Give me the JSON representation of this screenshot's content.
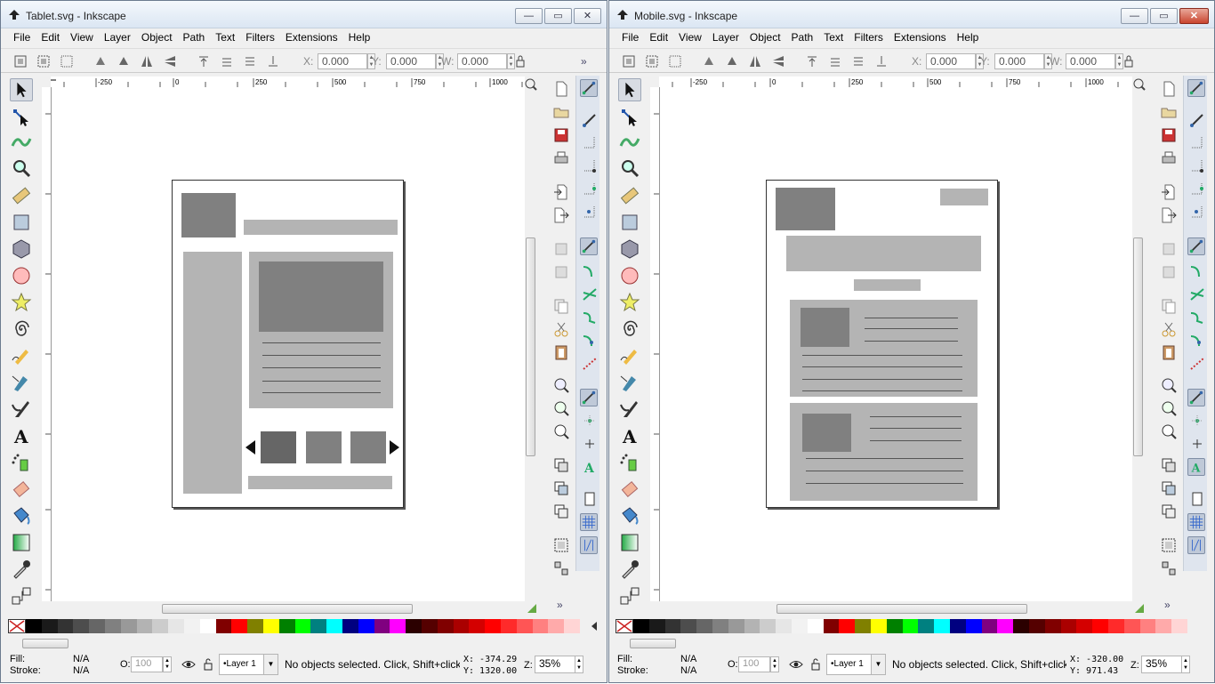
{
  "left_window": {
    "title": "Tablet.svg - Inkscape",
    "status": {
      "fill_label": "Fill:",
      "fill_value": "N/A",
      "stroke_label": "Stroke:",
      "stroke_value": "N/A",
      "opacity_label": "O:",
      "opacity_value": "100",
      "layer": "•Layer 1",
      "message": "No objects selected. Click, Shift+click",
      "x_readout": "X: -374.29",
      "y_readout": "Y: 1320.00",
      "zoom_label": "Z:",
      "zoom_value": "35%"
    }
  },
  "right_window": {
    "title": "Mobile.svg - Inkscape",
    "status": {
      "fill_label": "Fill:",
      "fill_value": "N/A",
      "stroke_label": "Stroke:",
      "stroke_value": "N/A",
      "opacity_label": "O:",
      "opacity_value": "100",
      "layer": "•Layer 1",
      "message": "No objects selected. Click, Shift+click",
      "x_readout": "X: -320.00",
      "y_readout": "Y:  971.43",
      "zoom_label": "Z:",
      "zoom_value": "35%"
    }
  },
  "menu": [
    "File",
    "Edit",
    "View",
    "Layer",
    "Object",
    "Path",
    "Text",
    "Filters",
    "Extensions",
    "Help"
  ],
  "toolbar": {
    "x_label": "X:",
    "x_value": "0.000",
    "y_label": "Y:",
    "y_value": "0.000",
    "w_label": "W:",
    "w_value": "0.000",
    "overflow": "»"
  },
  "window_buttons": {
    "minimize": "—",
    "maximize": "▭",
    "close": "✕"
  },
  "ruler": {
    "h_ticks": [
      "-250",
      "0",
      "250",
      "500",
      "750",
      "1000"
    ],
    "v_ticks_left": [
      "1250",
      "1000",
      "750",
      "500",
      "250",
      "0"
    ]
  },
  "palette_colors": [
    "#000000",
    "#1a1a1a",
    "#333333",
    "#4d4d4d",
    "#666666",
    "#808080",
    "#999999",
    "#b3b3b3",
    "#cccccc",
    "#e6e6e6",
    "#f2f2f2",
    "#ffffff",
    "#800000",
    "#ff0000",
    "#808000",
    "#ffff00",
    "#008000",
    "#00ff00",
    "#008080",
    "#00ffff",
    "#000080",
    "#0000ff",
    "#800080",
    "#ff00ff",
    "#2b0000",
    "#550000",
    "#800000",
    "#aa0000",
    "#d40000",
    "#ff0000",
    "#ff2a2a",
    "#ff5555",
    "#ff8080",
    "#ffaaaa",
    "#ffd5d5"
  ]
}
